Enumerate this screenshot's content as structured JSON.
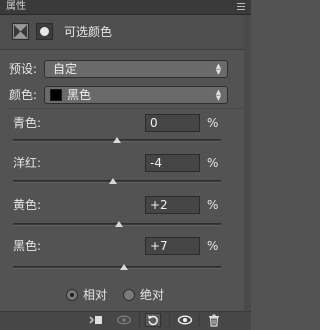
{
  "titlebar": {
    "title": "属性"
  },
  "header": {
    "title": "可选颜色"
  },
  "preset": {
    "label": "预设:",
    "value": "自定"
  },
  "colors": {
    "label": "颜色:",
    "value": "黑色",
    "swatch": "#000000"
  },
  "sliders": [
    {
      "label": "青色:",
      "value": "0",
      "unit": "%",
      "level": 0
    },
    {
      "label": "洋红:",
      "value": "-4",
      "unit": "%",
      "level": -4
    },
    {
      "label": "黄色:",
      "value": "+2",
      "unit": "%",
      "level": 2
    },
    {
      "label": "黑色:",
      "value": "+7",
      "unit": "%",
      "level": 7
    }
  ],
  "method": {
    "options": [
      {
        "label": "相对",
        "selected": true
      },
      {
        "label": "绝对",
        "selected": false
      }
    ]
  },
  "icons": [
    "menu-icon",
    "adjustment-icon",
    "mask-icon",
    "clip-to-layer-icon",
    "view-previous-icon",
    "reset-icon",
    "visibility-eye-icon",
    "trash-icon"
  ]
}
